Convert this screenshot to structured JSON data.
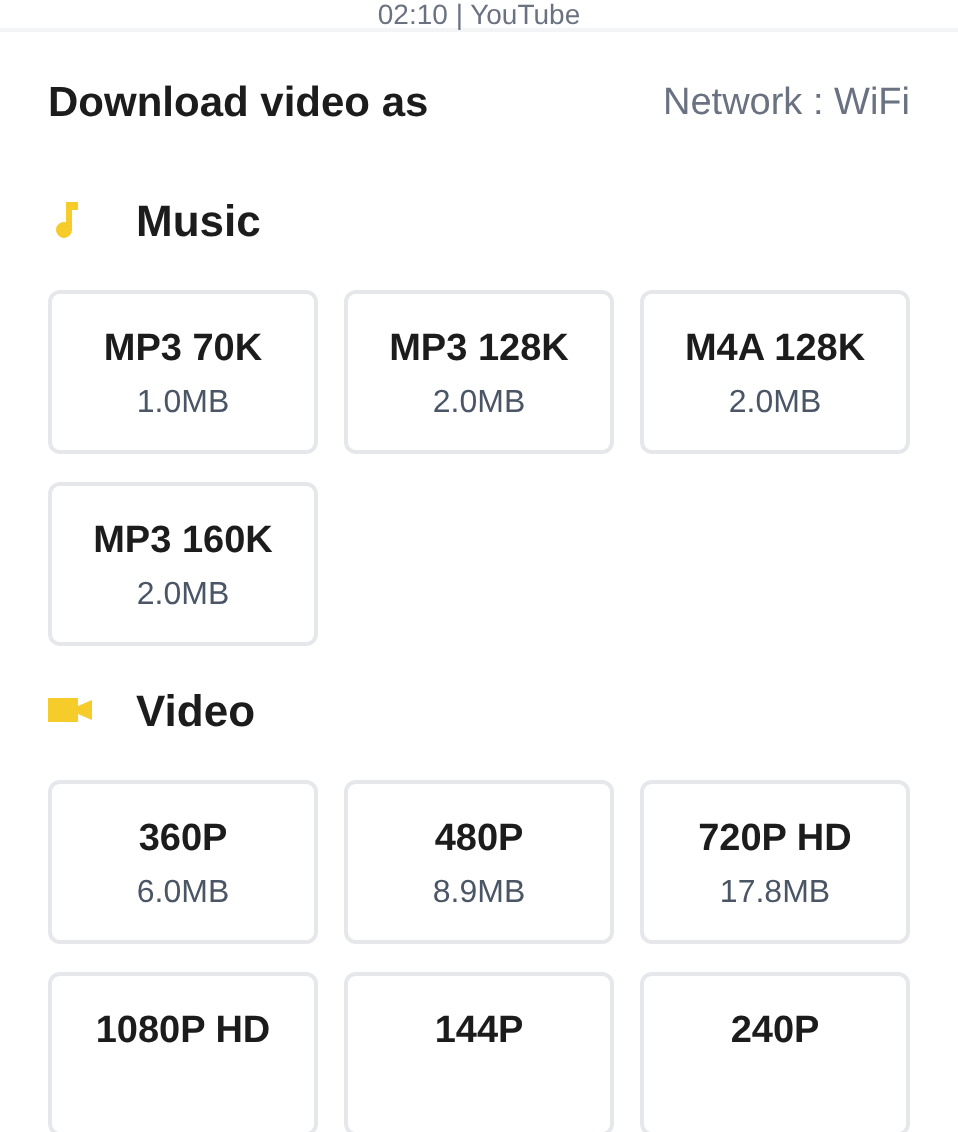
{
  "header": {
    "subtitle": "02:10 | YouTube"
  },
  "title": "Download video as",
  "network": "Network : WiFi",
  "sections": [
    {
      "kind": "music",
      "label": "Music",
      "options": [
        {
          "label": "MP3 70K",
          "size": "1.0MB"
        },
        {
          "label": "MP3 128K",
          "size": "2.0MB"
        },
        {
          "label": "M4A 128K",
          "size": "2.0MB"
        },
        {
          "label": "MP3 160K",
          "size": "2.0MB"
        }
      ]
    },
    {
      "kind": "video",
      "label": "Video",
      "options": [
        {
          "label": "360P",
          "size": "6.0MB"
        },
        {
          "label": "480P",
          "size": "8.9MB"
        },
        {
          "label": "720P HD",
          "size": "17.8MB"
        },
        {
          "label": "1080P HD"
        },
        {
          "label": "144P"
        },
        {
          "label": "240P"
        }
      ]
    }
  ]
}
